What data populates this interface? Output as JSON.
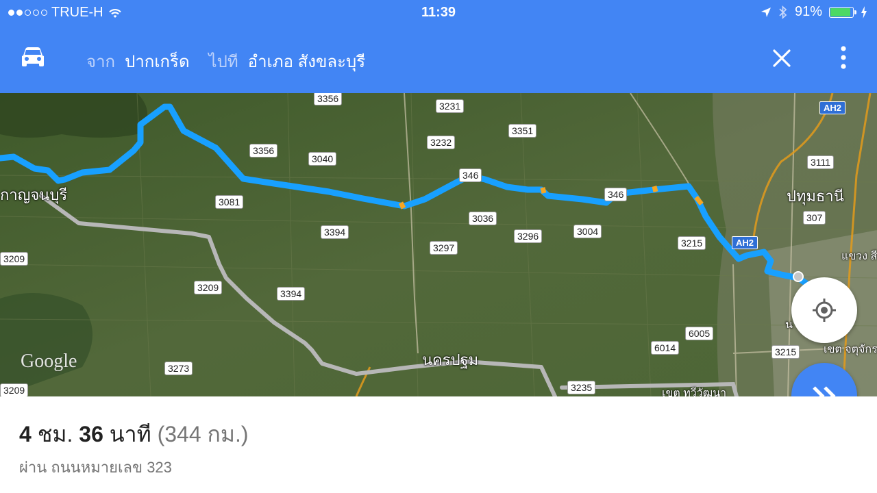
{
  "status_bar": {
    "carrier": "TRUE-H",
    "time": "11:39",
    "battery": "91%",
    "battery_level": 0.91,
    "signal_bars": 2,
    "signal_total": 5
  },
  "app_bar": {
    "from_label": "จาก",
    "from_value": "ปากเกร็ด",
    "to_label": "ไปที",
    "to_value": "อำเภอ สังขละบุรี",
    "mode_icon": "car-icon",
    "close_icon": "close-icon",
    "menu_icon": "more-vert-icon"
  },
  "map": {
    "attribution": "Google",
    "route_color": "#1aa3ff",
    "road_shields": [
      "3356",
      "3231",
      "3351",
      "3232",
      "3356",
      "3040",
      "346",
      "346",
      "3081",
      "3394",
      "3036",
      "3296",
      "3004",
      "3215",
      "3297",
      "3209",
      "3209",
      "3394",
      "6005",
      "6014",
      "3215",
      "3273",
      "3235",
      "3209",
      "3111",
      "307"
    ],
    "highway_labels": [
      "AH2",
      "AH2"
    ],
    "places": [
      "กาญจนบุรี",
      "ปทุมธานี",
      "นครปฐม",
      "แขวง สี",
      "น",
      "เขต จตุจักร",
      "เขต ทวีวัฒนา"
    ]
  },
  "summary": {
    "hours": "4",
    "hours_unit": "ชม.",
    "minutes": "36",
    "minutes_unit": "นาที",
    "distance": "(344 กม.)",
    "via": "ผ่าน ถนนหมายเลข 323"
  },
  "colors": {
    "primary": "#4285f4",
    "route": "#1aa3ff",
    "battery": "#4cd964"
  }
}
